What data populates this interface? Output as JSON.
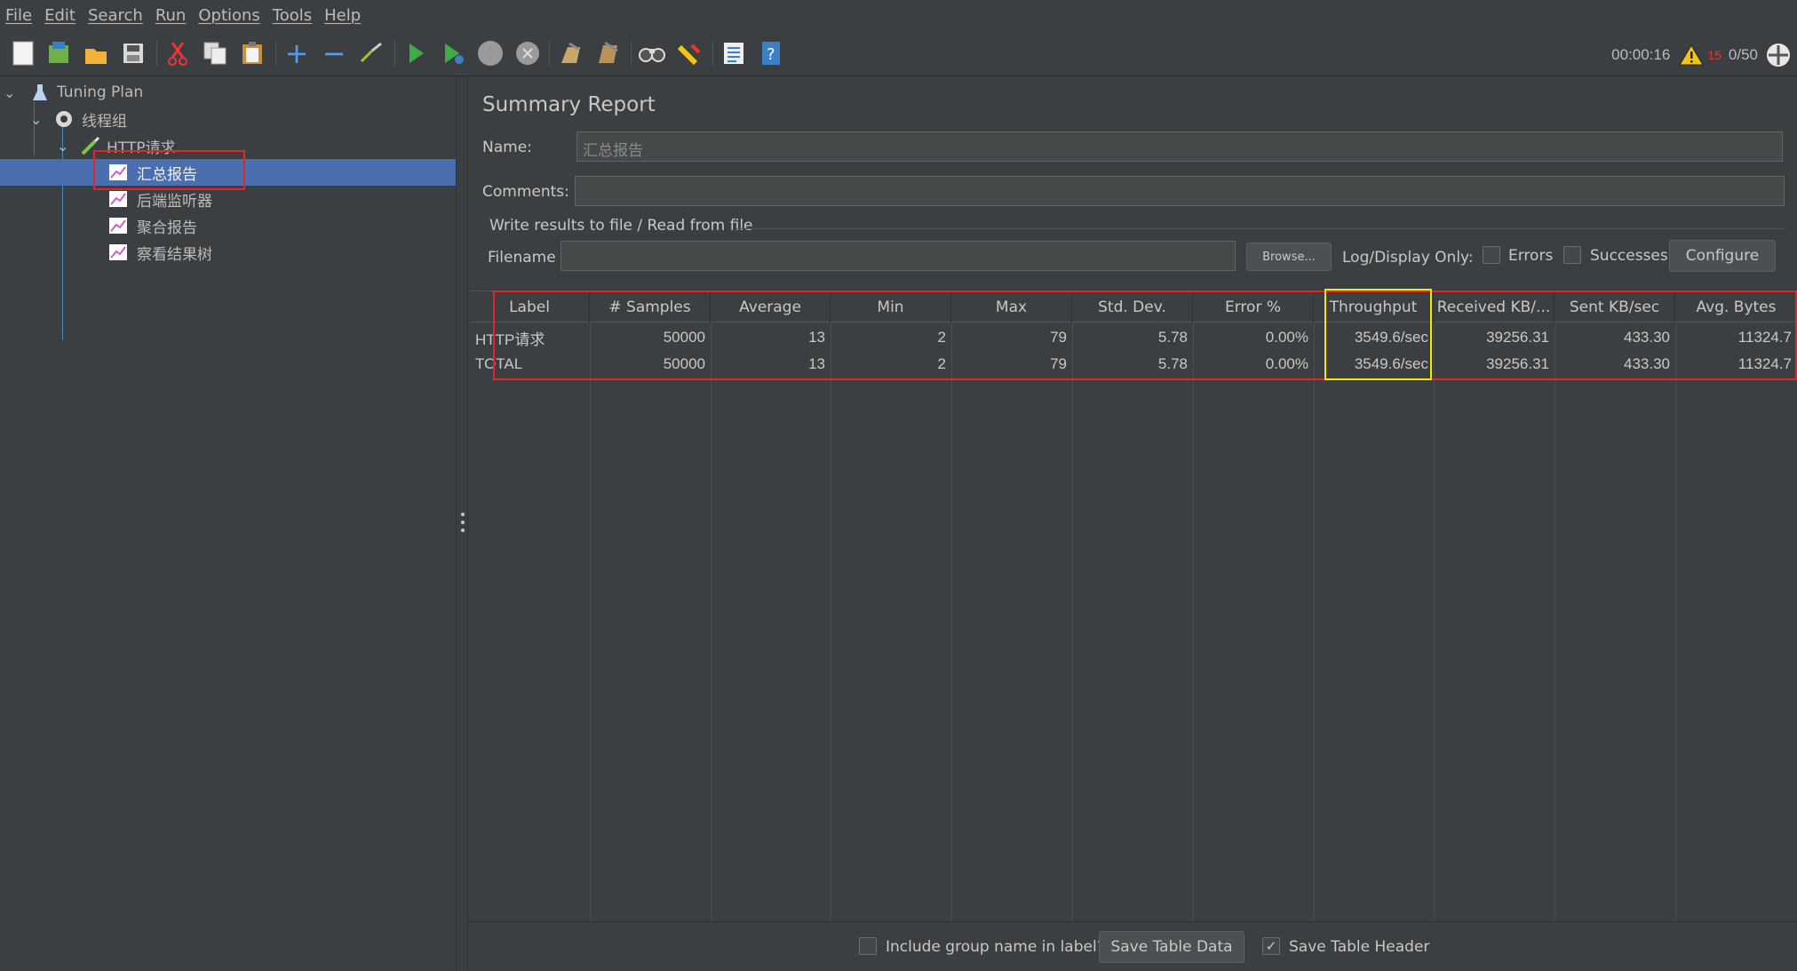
{
  "menu": [
    "File",
    "Edit",
    "Search",
    "Run",
    "Options",
    "Tools",
    "Help"
  ],
  "toolbar": {
    "icons": [
      "new-icon",
      "templates-icon",
      "open-icon",
      "save-icon",
      "cut-icon",
      "copy-icon",
      "paste-icon",
      "expand-icon",
      "collapse-icon",
      "toggle-icon",
      "start-icon",
      "start-no-pause-icon",
      "stop-icon",
      "shutdown-icon",
      "clear-icon",
      "clear-all-icon",
      "search-icon",
      "reset-search-icon",
      "function-helper-icon",
      "help-icon"
    ],
    "elapsed": "00:00:16",
    "warning_count": "15",
    "threads": "0/50"
  },
  "tree": {
    "root": "Tuning Plan",
    "thread_group": "线程组",
    "sampler": "HTTP请求",
    "listeners": [
      "汇总报告",
      "后端监听器",
      "聚合报告",
      "察看结果树"
    ],
    "selected_index": 0
  },
  "report": {
    "title": "Summary Report",
    "name_label": "Name:",
    "name_value": "汇总报告",
    "comments_label": "Comments:",
    "comments_value": "",
    "file_group_title": "Write results to file / Read from file",
    "filename_label": "Filename",
    "filename_value": "",
    "browse_label": "Browse...",
    "log_display_label": "Log/Display Only:",
    "errors_label": "Errors",
    "successes_label": "Successes",
    "configure_label": "Configure"
  },
  "table": {
    "columns": [
      "Label",
      "# Samples",
      "Average",
      "Min",
      "Max",
      "Std. Dev.",
      "Error %",
      "Throughput",
      "Received KB/...",
      "Sent KB/sec",
      "Avg. Bytes"
    ],
    "rows": [
      [
        "HTTP请求",
        "50000",
        "13",
        "2",
        "79",
        "5.78",
        "0.00%",
        "3549.6/sec",
        "39256.31",
        "433.30",
        "11324.7"
      ],
      [
        "TOTAL",
        "50000",
        "13",
        "2",
        "79",
        "5.78",
        "0.00%",
        "3549.6/sec",
        "39256.31",
        "433.30",
        "11324.7"
      ]
    ]
  },
  "footer": {
    "include_group_label": "Include group name in label?",
    "include_group_checked": false,
    "save_table_data_label": "Save Table Data",
    "save_table_header_label": "Save Table Header",
    "save_table_header_checked": true
  },
  "colors": {
    "background": "#3c3f41",
    "selection": "#4b6eaf",
    "highlight_red": "#e5232a",
    "highlight_yellow": "#f2e900",
    "warning": "#f0c419",
    "start_green": "#3fae49"
  }
}
